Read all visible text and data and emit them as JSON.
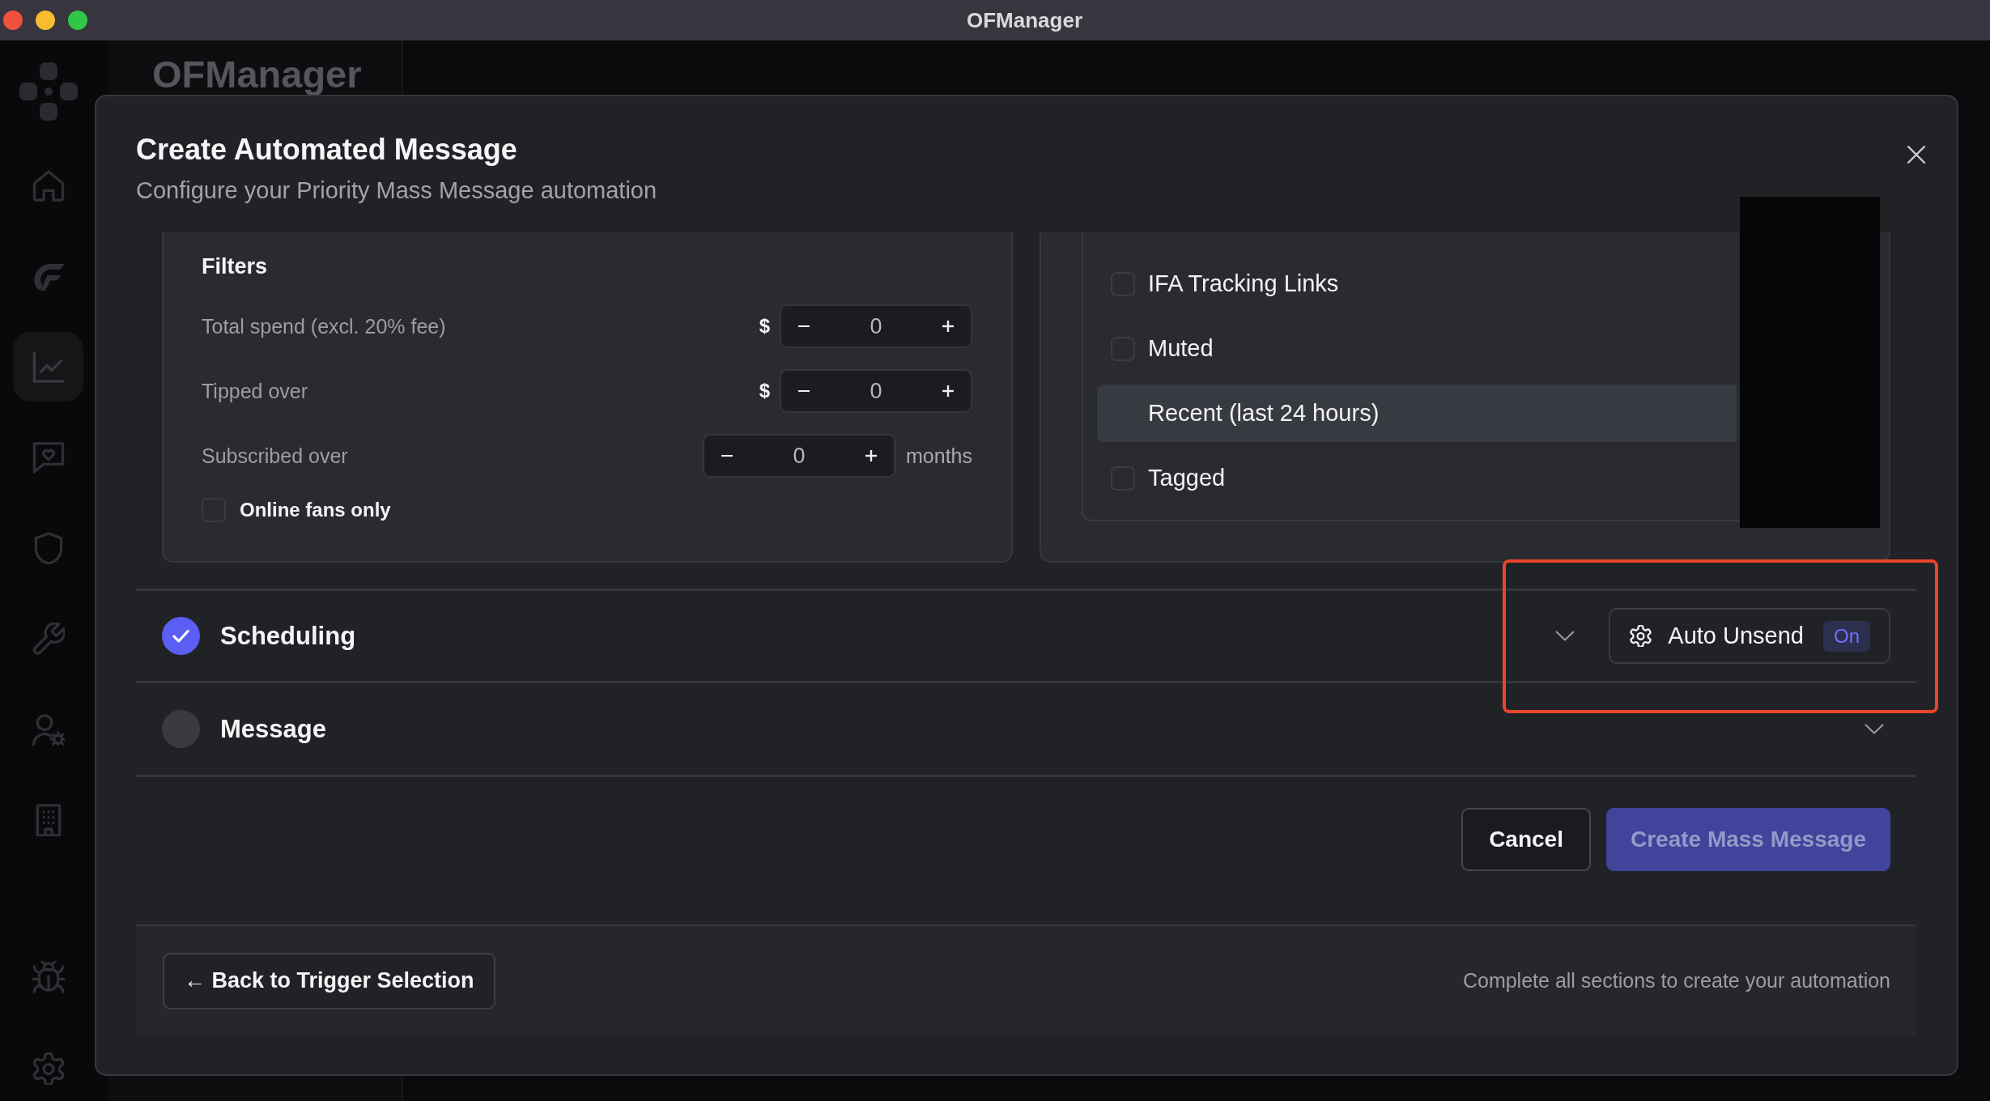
{
  "window": {
    "title": "OFManager"
  },
  "sidebar": {
    "items": [
      {
        "selected": false
      },
      {
        "selected": false
      },
      {
        "selected": true
      },
      {
        "selected": false
      },
      {
        "selected": false
      },
      {
        "selected": false
      },
      {
        "selected": false
      },
      {
        "selected": false
      },
      {
        "selected": false
      },
      {
        "selected": false
      }
    ]
  },
  "side_panel": {
    "title": "OFManager"
  },
  "dialog": {
    "title": "Create Automated Message",
    "subtitle": "Configure your Priority Mass Message automation",
    "filters": {
      "title": "Filters",
      "fields": [
        {
          "label": "Total spend (excl. 20% fee)",
          "prefix": "$",
          "value": "0"
        },
        {
          "label": "Tipped over",
          "prefix": "$",
          "value": "0"
        },
        {
          "label": "Subscribed over",
          "value": "0",
          "suffix": "months"
        }
      ],
      "online_only": {
        "label": "Online fans only",
        "checked": false
      }
    },
    "list_options": [
      {
        "label": "IFA Tracking Links",
        "checked": false,
        "highlighted": false
      },
      {
        "label": "Muted",
        "checked": false,
        "highlighted": false
      },
      {
        "label": "Recent (last 24 hours)",
        "checked": false,
        "highlighted": true
      },
      {
        "label": "Tagged",
        "checked": false,
        "highlighted": false
      }
    ],
    "sections": [
      {
        "title": "Scheduling",
        "completed": true,
        "expanded": false,
        "auto_unsend": {
          "label": "Auto Unsend",
          "status": "On",
          "on": true
        }
      },
      {
        "title": "Message",
        "completed": false,
        "expanded": false
      }
    ],
    "actions": [
      {
        "label": "Cancel",
        "kind": "secondary",
        "disabled": false
      },
      {
        "label": "Create Mass Message",
        "kind": "primary",
        "disabled": true
      }
    ],
    "footer": {
      "back": "← Back to Trigger Selection",
      "hint": "Complete all sections to create your automation"
    }
  },
  "annotations": {
    "redaction_box": true,
    "highlight_frame": true
  }
}
